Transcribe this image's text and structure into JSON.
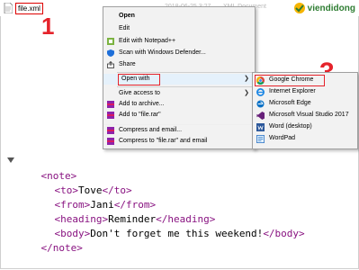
{
  "explorer": {
    "file_name": "file.xml",
    "modified": "2018-06-25 3:27",
    "type": "XML Document"
  },
  "watermark": {
    "brand": "viendidong"
  },
  "steps": {
    "one": "1",
    "two": "2",
    "three": "3"
  },
  "context_menu": {
    "items": [
      {
        "label": "Open",
        "bold": true
      },
      {
        "label": "Edit"
      },
      {
        "label": "Edit with Notepad++"
      },
      {
        "label": "Scan with Windows Defender..."
      },
      {
        "label": "Share"
      },
      {
        "label": "Open with"
      },
      {
        "label": "Give access to"
      },
      {
        "label": "Add to archive..."
      },
      {
        "label": "Add to \"file.rar\""
      },
      {
        "label": "Compress and email..."
      },
      {
        "label": "Compress to \"file.rar\" and email"
      }
    ]
  },
  "open_with_menu": {
    "items": [
      {
        "label": "Google Chrome"
      },
      {
        "label": "Internet Explorer"
      },
      {
        "label": "Microsoft Edge"
      },
      {
        "label": "Microsoft Visual Studio 2017"
      },
      {
        "label": "Word (desktop)"
      },
      {
        "label": "WordPad"
      }
    ]
  },
  "xml": {
    "note_open": "<note>",
    "to_open": "<to>",
    "to_text": "Tove",
    "to_close": "</to>",
    "from_open": "<from>",
    "from_text": "Jani",
    "from_close": "</from>",
    "heading_open": "<heading>",
    "heading_text": "Reminder",
    "heading_close": "</heading>",
    "body_open": "<body>",
    "body_text": "Don't forget me this weekend!",
    "body_close": "</body>",
    "note_close": "</note>"
  }
}
